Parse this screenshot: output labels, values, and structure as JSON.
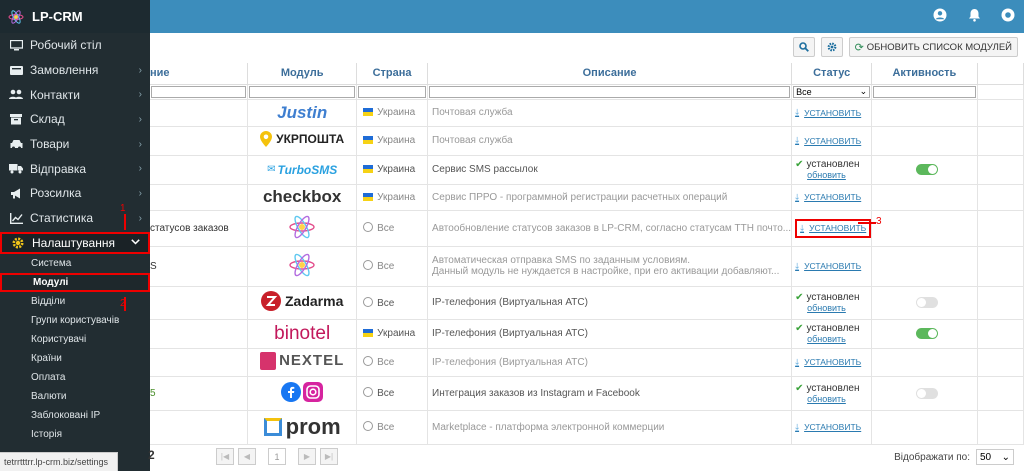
{
  "app": {
    "title": "LP-CRM"
  },
  "sidebar": {
    "items": [
      {
        "label": "Робочий стіл",
        "icon": "desktop-icon",
        "has_children": false
      },
      {
        "label": "Замовлення",
        "icon": "cart-icon",
        "has_children": true
      },
      {
        "label": "Контакти",
        "icon": "users-icon",
        "has_children": true
      },
      {
        "label": "Склад",
        "icon": "box-icon",
        "has_children": true
      },
      {
        "label": "Товари",
        "icon": "car-icon",
        "has_children": true
      },
      {
        "label": "Відправка",
        "icon": "truck-icon",
        "has_children": true
      },
      {
        "label": "Розсилка",
        "icon": "megaphone-icon",
        "has_children": true
      },
      {
        "label": "Статистика",
        "icon": "chart-icon",
        "has_children": true
      },
      {
        "label": "Налаштування",
        "icon": "gear-icon",
        "has_children": true,
        "active": true
      }
    ],
    "subitems": [
      {
        "label": "Система"
      },
      {
        "label": "Модулі",
        "current": true
      },
      {
        "label": "Відділи"
      },
      {
        "label": "Групи користувачів"
      },
      {
        "label": "Користувачі"
      },
      {
        "label": "Країни"
      },
      {
        "label": "Оплата"
      },
      {
        "label": "Валюти"
      },
      {
        "label": "Заблоковані IP"
      },
      {
        "label": "Історія"
      }
    ],
    "status_url": "tetrrtttrr.lp-crm.biz/settings"
  },
  "toolbar": {
    "search_icon": "search-icon",
    "settings_icon": "gear-icon",
    "refresh_label": "ОБНОВИТЬ СПИСОК МОДУЛЕЙ"
  },
  "table": {
    "headers": {
      "name": "ние",
      "module": "Модуль",
      "country": "Страна",
      "description": "Описание",
      "status": "Статус",
      "activity": "Активность"
    },
    "status_filter": "Все",
    "rows": [
      {
        "name": "",
        "logo": "justin",
        "logo_text": "Justin",
        "country": "Украина",
        "country_flag": "ua",
        "description": "Почтовая служба",
        "dim": true,
        "status": "install",
        "install_label": "УСТАНОВИТЬ",
        "active": null
      },
      {
        "name": "",
        "logo": "ukrposhta",
        "logo_text": "УКРПОШТА",
        "country": "Украина",
        "country_flag": "ua",
        "description": "Почтовая служба",
        "dim": true,
        "status": "install",
        "install_label": "УСТАНОВИТЬ",
        "active": null
      },
      {
        "name": "",
        "logo": "turbosms",
        "logo_text": "TurboSMS",
        "country": "Украина",
        "country_flag": "ua",
        "description": "Сервис SMS рассылок",
        "dim": false,
        "status": "installed",
        "installed_label": "установлен",
        "update_label": "обновить",
        "active": true
      },
      {
        "name": "",
        "logo": "checkbox",
        "logo_text": "checkbox",
        "country": "Украина",
        "country_flag": "ua",
        "description": "Сервис ПРРО - программной регистрации расчетных операций",
        "dim": true,
        "status": "install",
        "install_label": "УСТАНОВИТЬ",
        "active": null
      },
      {
        "name": "статусов заказов",
        "logo": "lpcrm",
        "logo_text": "",
        "country": "Все",
        "country_flag": "globe",
        "description": "Автообновление статусов заказов в LP-CRM, согласно статусам ТТН почто...",
        "dim": true,
        "status": "install",
        "install_label": "УСТАНОВИТЬ",
        "highlight": true,
        "active": null
      },
      {
        "name": "S",
        "logo": "lpcrm",
        "logo_text": "",
        "country": "Все",
        "country_flag": "globe",
        "description": "Автоматическая отправка SMS по заданным условиям.",
        "description2": "Данный модуль не нуждается в настройке, при его активации добавляют...",
        "dim": true,
        "status": "install",
        "install_label": "УСТАНОВИТЬ",
        "active": null
      },
      {
        "name": "",
        "logo": "zadarma",
        "logo_text": "Zadarma",
        "country": "Все",
        "country_flag": "globe",
        "description": "IP-телефония (Виртуальная АТС)",
        "dim": false,
        "status": "installed",
        "installed_label": "установлен",
        "update_label": "обновить",
        "active": false
      },
      {
        "name": "",
        "logo": "binotel",
        "logo_text": "binotel",
        "country": "Украина",
        "country_flag": "ua",
        "description": "IP-телефония (Виртуальная АТС)",
        "dim": false,
        "status": "installed",
        "installed_label": "установлен",
        "update_label": "обновить",
        "active": true
      },
      {
        "name": "",
        "logo": "nextel",
        "logo_text": "NEXTEL",
        "country": "Все",
        "country_flag": "globe",
        "description": "IP-телефония (Виртуальная АТС)",
        "dim": true,
        "status": "install",
        "install_label": "УСТАНОВИТЬ",
        "active": null
      },
      {
        "name": "5",
        "logo": "fbinsta",
        "logo_text": "",
        "country": "Все",
        "country_flag": "globe",
        "description": "Интеграция заказов из Instagram и Facebook",
        "dim": false,
        "status": "installed",
        "installed_label": "установлен",
        "update_label": "обновить",
        "active": false
      },
      {
        "name": "",
        "logo": "prom",
        "logo_text": "prom",
        "country": "Все",
        "country_flag": "globe",
        "description": "Marketplace - платформа электронной коммерции",
        "dim": true,
        "status": "install",
        "install_label": "УСТАНОВИТЬ",
        "active": null
      }
    ]
  },
  "pagination": {
    "left_text": "2",
    "page": "1",
    "per_page_label": "Відображати по:",
    "per_page": "50"
  },
  "annotations": [
    "1",
    "2",
    "3"
  ],
  "colors": {
    "topbar": "#3c8dbc",
    "sidebar": "#222d32",
    "highlight": "#ee0000",
    "accent": "#3c6e9a"
  }
}
